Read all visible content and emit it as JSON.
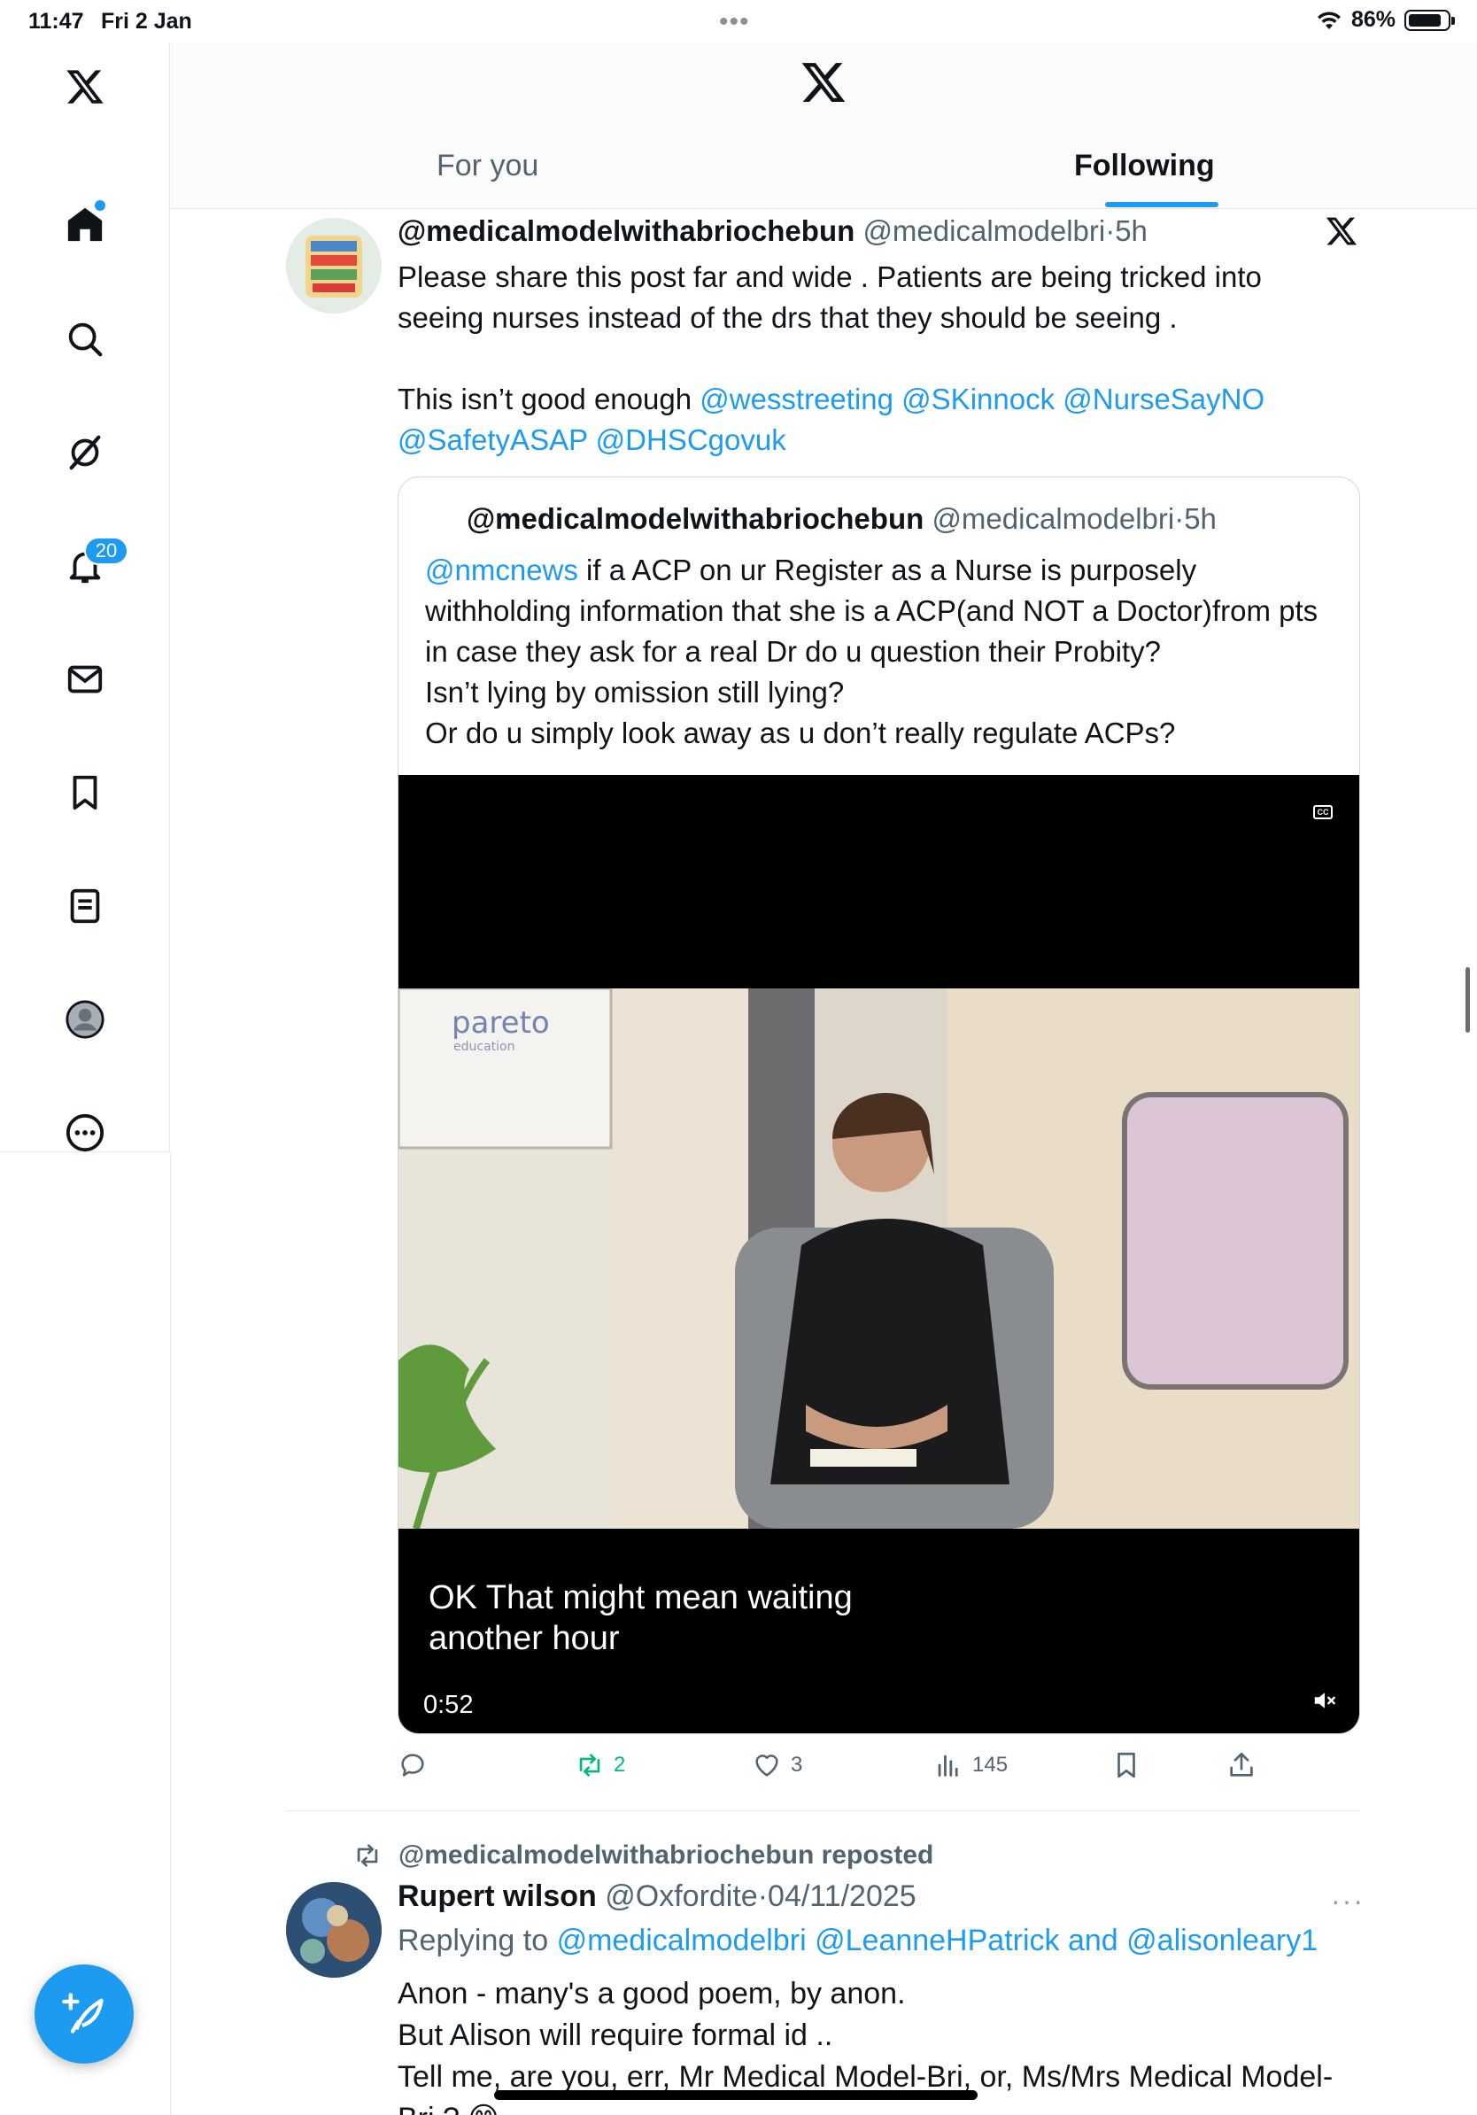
{
  "status_bar": {
    "time": "11:47",
    "date": "Fri 2 Jan",
    "battery": "86%",
    "dots": "•••"
  },
  "nav": {
    "items": [
      {
        "name": "x-logo"
      },
      {
        "name": "home"
      },
      {
        "name": "search"
      },
      {
        "name": "grok"
      },
      {
        "name": "notifications",
        "badge": "20"
      },
      {
        "name": "messages"
      },
      {
        "name": "bookmarks"
      },
      {
        "name": "lists"
      },
      {
        "name": "profile"
      },
      {
        "name": "more"
      }
    ]
  },
  "header": {
    "tabs": [
      {
        "label": "For you",
        "active": false
      },
      {
        "label": "Following",
        "active": true
      }
    ]
  },
  "tweet1": {
    "display_name": "@medicalmodelwithabriochebun",
    "handle": "@medicalmodelbri",
    "sep": "·",
    "time": "5h",
    "text_line1": "Please share this post far and wide . Patients are being tricked into seeing nurses instead of the drs that they should be seeing .",
    "text_line2_prefix": "This isn’t good enough",
    "mentions": [
      "@wesstreeting",
      "@SKinnock",
      "@NurseSayNO",
      "@SafetyASAP",
      "@DHSCgovuk"
    ],
    "quote": {
      "display_name": "@medicalmodelwithabriochebun",
      "handle": "@medicalmodelbri",
      "sep": "·",
      "time": "5h",
      "mention": "@nmcnews",
      "text_a": " if a ACP on ur Register as a Nurse is purposely withholding information that she is a ACP(and NOT a Doctor)from pts in case they ask for a real Dr do u question their Probity?",
      "text_b": "Isn’t lying by omission still lying?",
      "text_c": "Or do u simply look away as u don’t really regulate ACPs?",
      "video": {
        "caption": "OK That might mean waiting another hour",
        "duration": "0:52",
        "cc_label": "CC",
        "brand": "pareto",
        "brand_sub": "education",
        "muted": true
      }
    },
    "stats": {
      "replies": "",
      "reposts": "2",
      "likes": "3",
      "views": "145"
    },
    "colors": {
      "repost_active": "#00ba7c"
    }
  },
  "tweet2": {
    "reposted_by": "@medicalmodelwithabriochebun reposted",
    "display_name": "Rupert wilson",
    "handle": "@Oxfordite",
    "sep": "·",
    "date": "04/11/2025",
    "more": "···",
    "replying_prefix": "Replying to",
    "replying_to": [
      "@medicalmodelbri",
      "@LeanneHPatrick"
    ],
    "replying_and": "and",
    "replying_last": "@alisonleary1",
    "line1": "Anon - many's a good poem, by anon.",
    "line2": "But Alison will require formal id ..",
    "line3": "Tell me, are you, err, Mr Medical Model-Bri, or, Ms/Mrs Medical Model-Bri ? 😊"
  },
  "colors": {
    "accent": "#1d9bf0",
    "text": "#0f1419",
    "secondary": "#536471",
    "border": "#e6e9ec"
  }
}
